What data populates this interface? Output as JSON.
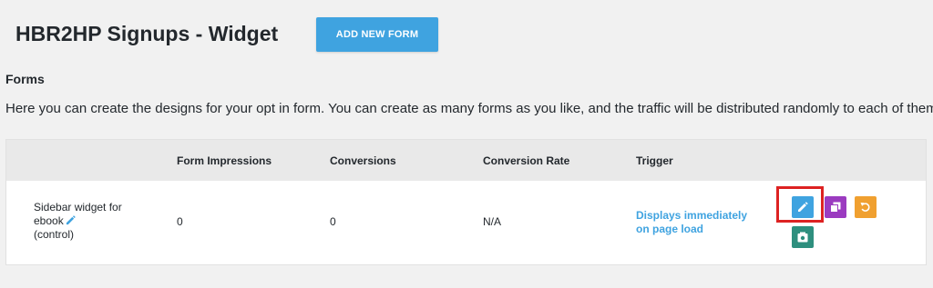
{
  "header": {
    "title": "HBR2HP Signups - Widget",
    "add_button_label": "ADD NEW FORM"
  },
  "forms_section": {
    "heading": "Forms",
    "description": "Here you can create the designs for your opt in form. You can create as many forms as you like, and the traffic will be distributed randomly to each of them."
  },
  "table": {
    "columns": [
      "",
      "Form Impressions",
      "Conversions",
      "Conversion Rate",
      "Trigger",
      ""
    ],
    "rows": [
      {
        "name_line1": "Sidebar widget for",
        "name_line2": "ebook",
        "name_line3": "(control)",
        "impressions": "0",
        "conversions": "0",
        "conversion_rate": "N/A",
        "trigger_line1": "Displays immediately",
        "trigger_line2": "on page load"
      }
    ]
  },
  "actions": {
    "edit_icon": "pencil-icon",
    "duplicate_icon": "copy-icon",
    "reset_icon": "undo-icon",
    "save_icon": "save-icon"
  },
  "colors": {
    "accent": "#3fa3e0",
    "duplicate": "#9b3bc0",
    "reset": "#f0a030",
    "save": "#2e8f7e",
    "highlight": "#dd2222"
  }
}
